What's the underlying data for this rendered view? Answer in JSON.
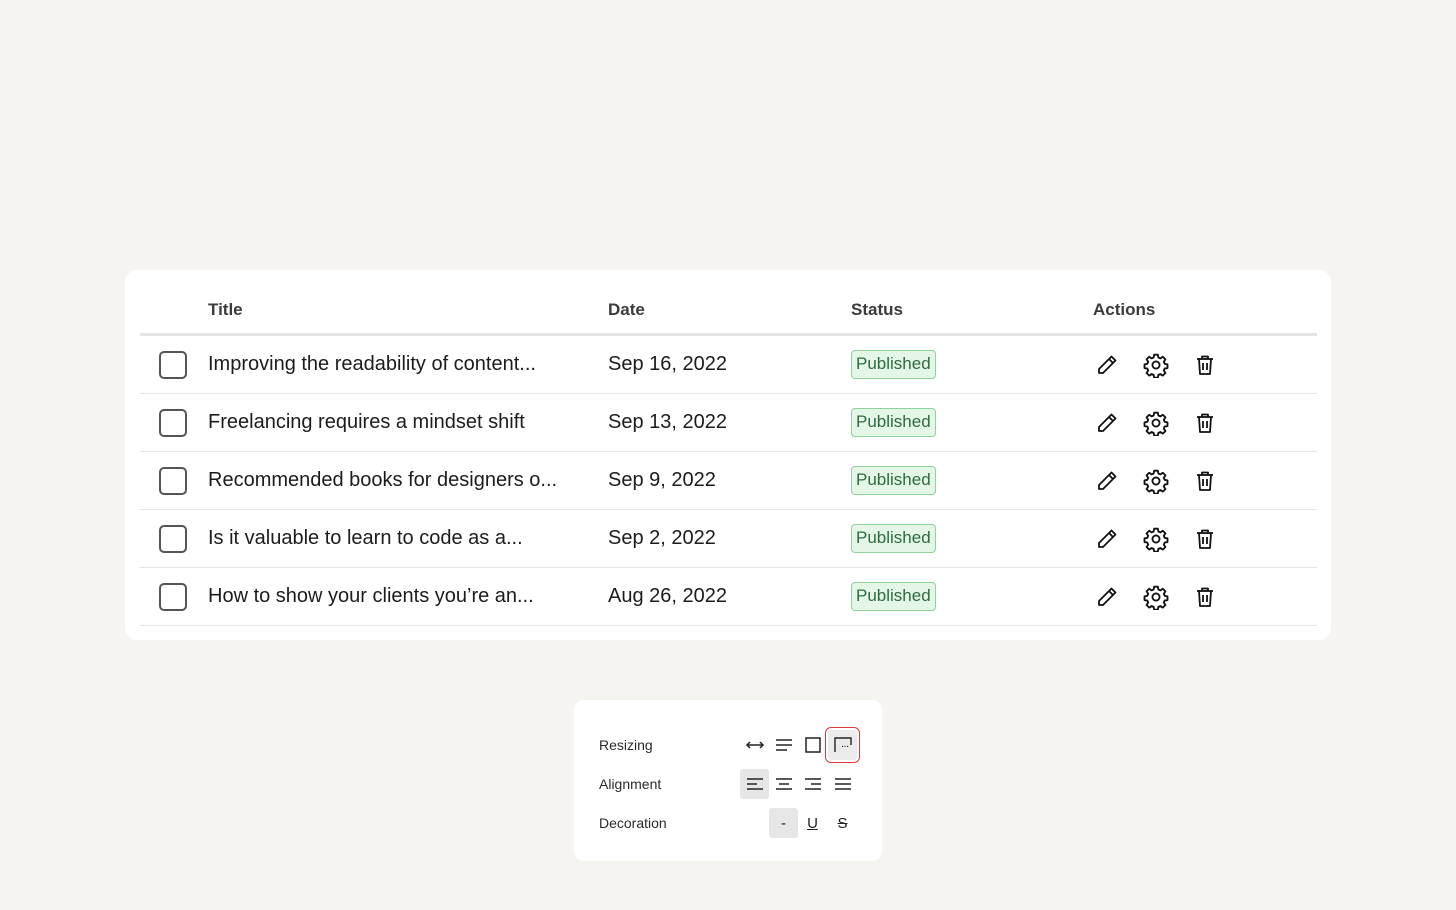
{
  "table": {
    "headers": {
      "title": "Title",
      "date": "Date",
      "status": "Status",
      "actions": "Actions"
    },
    "rows": [
      {
        "title": "Improving the readability of content...",
        "date": "Sep 16, 2022",
        "status": "Published"
      },
      {
        "title": "Freelancing requires a mindset shift",
        "date": "Sep 13, 2022",
        "status": "Published"
      },
      {
        "title": "Recommended books for designers o...",
        "date": "Sep 9, 2022",
        "status": "Published"
      },
      {
        "title": "Is it valuable to learn to code as a...",
        "date": "Sep 2, 2022",
        "status": "Published"
      },
      {
        "title": "How to show your clients you’re an...",
        "date": "Aug 26, 2022",
        "status": "Published"
      }
    ],
    "action_icons": [
      "pencil-icon",
      "gear-icon",
      "trash-icon"
    ]
  },
  "panel": {
    "resizing": {
      "label": "Resizing",
      "options": [
        "auto-width-icon",
        "auto-height-icon",
        "fixed-size-icon",
        "truncate-text-icon"
      ],
      "selected": "truncate-text-icon",
      "truncate_glyph": "..."
    },
    "alignment": {
      "label": "Alignment",
      "options": [
        "align-left-icon",
        "align-center-icon",
        "align-right-icon",
        "align-justify-icon"
      ],
      "selected": "align-left-icon"
    },
    "decoration": {
      "label": "Decoration",
      "none_label": "-",
      "underline_label": "U",
      "strikethrough_label": "S",
      "selected": "none"
    }
  },
  "colors": {
    "background": "#f5f4f0",
    "badge_bg": "#e4f6e6",
    "badge_border": "#8fd29c",
    "badge_text": "#2f6b3f",
    "highlight_outline": "#e0383e"
  }
}
